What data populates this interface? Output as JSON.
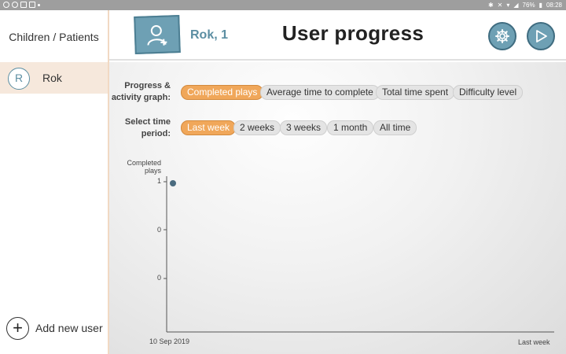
{
  "statusbar": {
    "battery": "76%",
    "time": "08:28"
  },
  "sidebar": {
    "title": "Children / Patients",
    "items": [
      {
        "avatar_letter": "R",
        "label": "Rok"
      }
    ],
    "add_user_label": "Add new user",
    "add_user_icon": "+"
  },
  "header": {
    "user_name": "Rok, 1",
    "title": "User progress",
    "icons": {
      "user_card": "add-user-icon",
      "settings": "gear-icon",
      "play": "play-icon"
    }
  },
  "controls": {
    "graph_label": "Progress &\nactivity graph:",
    "graph_options": [
      "Completed plays",
      "Average time to complete",
      "Total time spent",
      "Difficulty level"
    ],
    "graph_selected": 0,
    "period_label": "Select time\nperiod:",
    "period_options": [
      "Last week",
      "2 weeks",
      "3 weeks",
      "1 month",
      "All time"
    ],
    "period_selected": 0
  },
  "colors": {
    "accent": "#f0a75a",
    "primary": "#6ea0b4",
    "point": "#4a6b7f"
  },
  "chart_data": {
    "type": "scatter",
    "ylabel": "Completed plays",
    "ytick_labels": [
      "1",
      "0",
      "0"
    ],
    "x_start_label": "10 Sep 2019",
    "x_end_label": "Last week",
    "points": [
      {
        "x": "10 Sep 2019",
        "y": 1
      }
    ]
  }
}
